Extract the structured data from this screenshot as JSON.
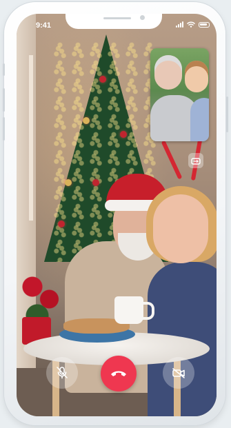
{
  "status_bar": {
    "time": "9:41",
    "icons": [
      "signal-icon",
      "wifi-icon",
      "battery-icon"
    ]
  },
  "call": {
    "pip_preview": "self-view-thumbnail",
    "controls": {
      "mute_icon": "mic-off-icon",
      "end_icon": "phone-hangup-icon",
      "video_icon": "video-off-icon",
      "switch_camera_icon": "camera-switch-icon"
    }
  },
  "colors": {
    "end_call": "#ef3750",
    "control_bg": "rgba(255,255,255,0.28)",
    "frame": "#ffffff"
  }
}
